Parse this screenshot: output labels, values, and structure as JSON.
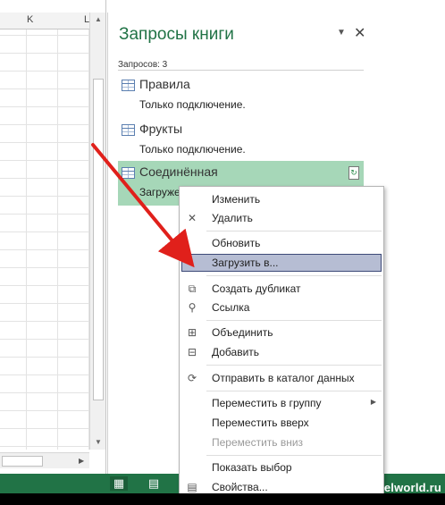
{
  "sheet": {
    "columns": [
      "K",
      "L"
    ]
  },
  "pane": {
    "title": "Запросы книги",
    "count_label": "Запросов: 3",
    "options_glyph": "▼",
    "close_glyph": "✕",
    "queries": [
      {
        "name": "Правила",
        "status": "Только подключение."
      },
      {
        "name": "Фрукты",
        "status": "Только подключение."
      },
      {
        "name": "Соединённая",
        "status": "Загруже"
      }
    ]
  },
  "menu": {
    "items": [
      {
        "label": "Изменить",
        "icon": "",
        "icon_name": "none"
      },
      {
        "label": "Удалить",
        "icon": "✕",
        "icon_name": "delete-icon"
      },
      {
        "label": "Обновить",
        "icon": "",
        "icon_name": "none"
      },
      {
        "label": "Загрузить в...",
        "icon": "",
        "icon_name": "none"
      },
      {
        "label": "Создать дубликат",
        "icon": "⧉",
        "icon_name": "duplicate-icon"
      },
      {
        "label": "Ссылка",
        "icon": "⚲",
        "icon_name": "paperclip-icon"
      },
      {
        "label": "Объединить",
        "icon": "⊞",
        "icon_name": "merge-icon"
      },
      {
        "label": "Добавить",
        "icon": "⊟",
        "icon_name": "append-icon"
      },
      {
        "label": "Отправить в каталог данных",
        "icon": "⟳",
        "icon_name": "data-catalog-icon"
      },
      {
        "label": "Переместить в группу",
        "icon": "",
        "icon_name": "none"
      },
      {
        "label": "Переместить вверх",
        "icon": "",
        "icon_name": "none"
      },
      {
        "label": "Переместить вниз",
        "icon": "",
        "icon_name": "none"
      },
      {
        "label": "Показать выбор",
        "icon": "",
        "icon_name": "none"
      },
      {
        "label": "Свойства...",
        "icon": "▤",
        "icon_name": "properties-icon"
      }
    ],
    "highlighted": "Загрузить в...",
    "disabled": [
      "Переместить вниз"
    ]
  },
  "watermark": "www.excelworld.ru",
  "colors": {
    "accent": "#217346",
    "selected_query": "#a6d7b8",
    "menu_highlight": "#b6bdd3",
    "arrow": "#e0201b"
  },
  "icons": {
    "table": "table-icon",
    "refresh": "refresh-icon",
    "normal_view": "normal-view-icon",
    "page_layout": "page-layout-view-icon"
  }
}
